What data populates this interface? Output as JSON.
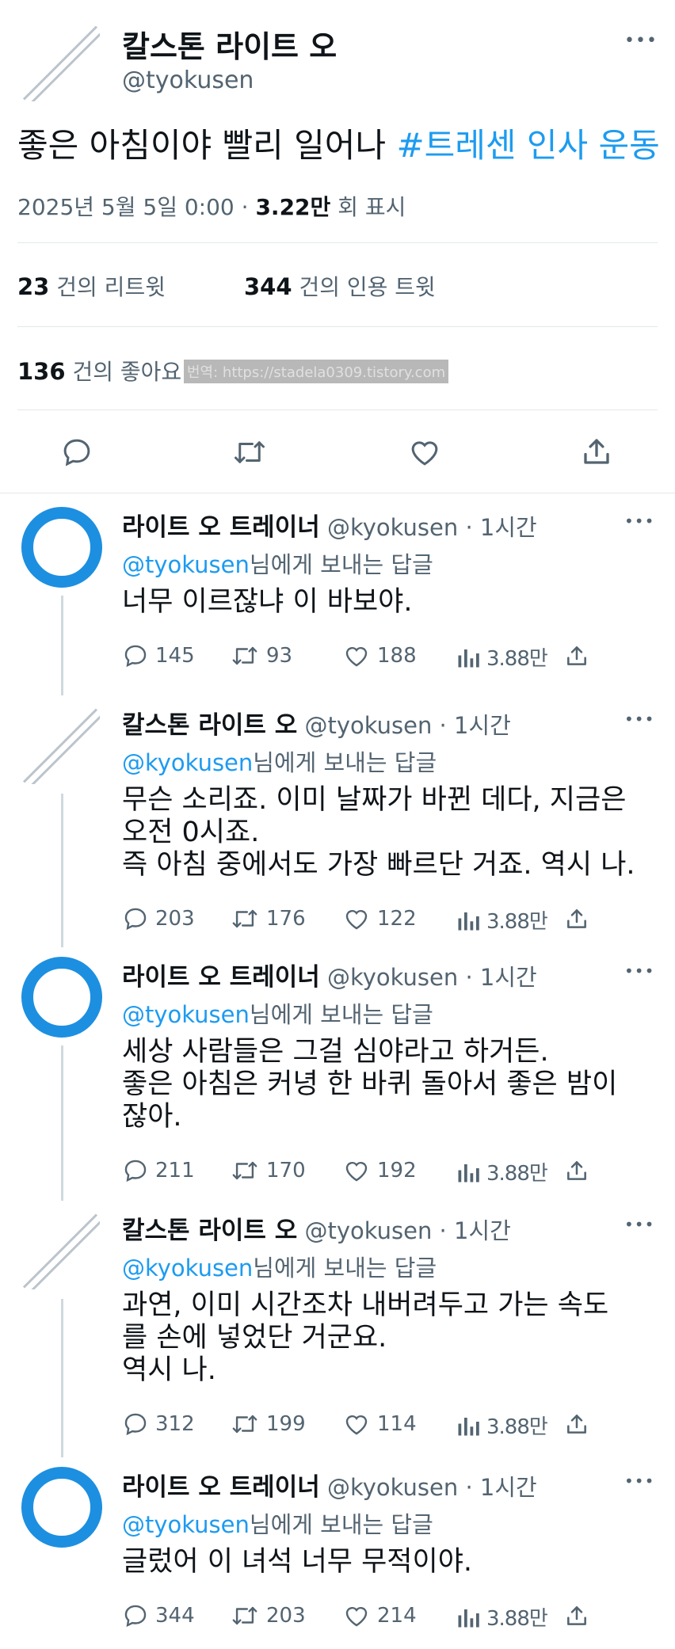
{
  "main": {
    "name": "칼스톤 라이트 오",
    "handle": "@tyokusen",
    "text": "좋은 아침이야 빨리 일어나 ",
    "hashtag": "#트레센 인사 운동",
    "date": "2025년 5월 5일  0:00 · ",
    "views_count": "3.22만",
    "views_label": " 회 표시",
    "retweets_count": "23",
    "retweets_label": " 건의 리트윗",
    "quotes_count": "344",
    "quotes_label": " 건의 인용 트윗",
    "likes_count": "136",
    "likes_label": " 건의 좋아요",
    "watermark": "번역: https://stadela0309.tistory.com"
  },
  "replies": [
    {
      "name": "라이트 오 트레이너",
      "handle": " @kyokusen · 1시간",
      "to": "@tyokusen",
      "to_suffix": "님에게 보내는 답글",
      "lines": [
        "너무 이르잖냐 이 바보야."
      ],
      "replies": "145",
      "retweets": "93",
      "likes": "188",
      "views": "3.88만"
    },
    {
      "name": "칼스톤 라이트 오",
      "handle": " @tyokusen · 1시간",
      "to": "@kyokusen",
      "to_suffix": "님에게 보내는 답글",
      "lines": [
        "무슨 소리죠. 이미 날짜가 바뀐 데다, 지금은",
        "오전 0시죠.",
        "즉 아침 중에서도 가장 빠르단 거죠. 역시 나."
      ],
      "replies": "203",
      "retweets": "176",
      "likes": "122",
      "views": "3.88만"
    },
    {
      "name": "라이트 오 트레이너",
      "handle": " @kyokusen · 1시간",
      "to": "@tyokusen",
      "to_suffix": "님에게 보내는 답글",
      "lines": [
        "세상 사람들은 그걸 심야라고 하거든.",
        "좋은 아침은 커녕 한 바퀴 돌아서 좋은 밤이",
        "잖아."
      ],
      "replies": "211",
      "retweets": "170",
      "likes": "192",
      "views": "3.88만"
    },
    {
      "name": "칼스톤 라이트 오",
      "handle": " @tyokusen · 1시간",
      "to": "@kyokusen",
      "to_suffix": "님에게 보내는 답글",
      "lines": [
        "과연, 이미 시간조차 내버려두고 가는 속도",
        "를 손에 넣었단 거군요.",
        "역시 나."
      ],
      "replies": "312",
      "retweets": "199",
      "likes": "114",
      "views": "3.88만"
    },
    {
      "name": "라이트 오 트레이너",
      "handle": " @kyokusen · 1시간",
      "to": "@tyokusen",
      "to_suffix": "님에게 보내는 답글",
      "lines": [
        "글렀어 이 녀석 너무 무적이야."
      ],
      "replies": "344",
      "retweets": "203",
      "likes": "214",
      "views": "3.88만"
    }
  ],
  "more_glyph": "•••",
  "colors": {
    "accent": "#1d9bf0",
    "ring": "#1d8fe0",
    "muted": "#536471"
  }
}
